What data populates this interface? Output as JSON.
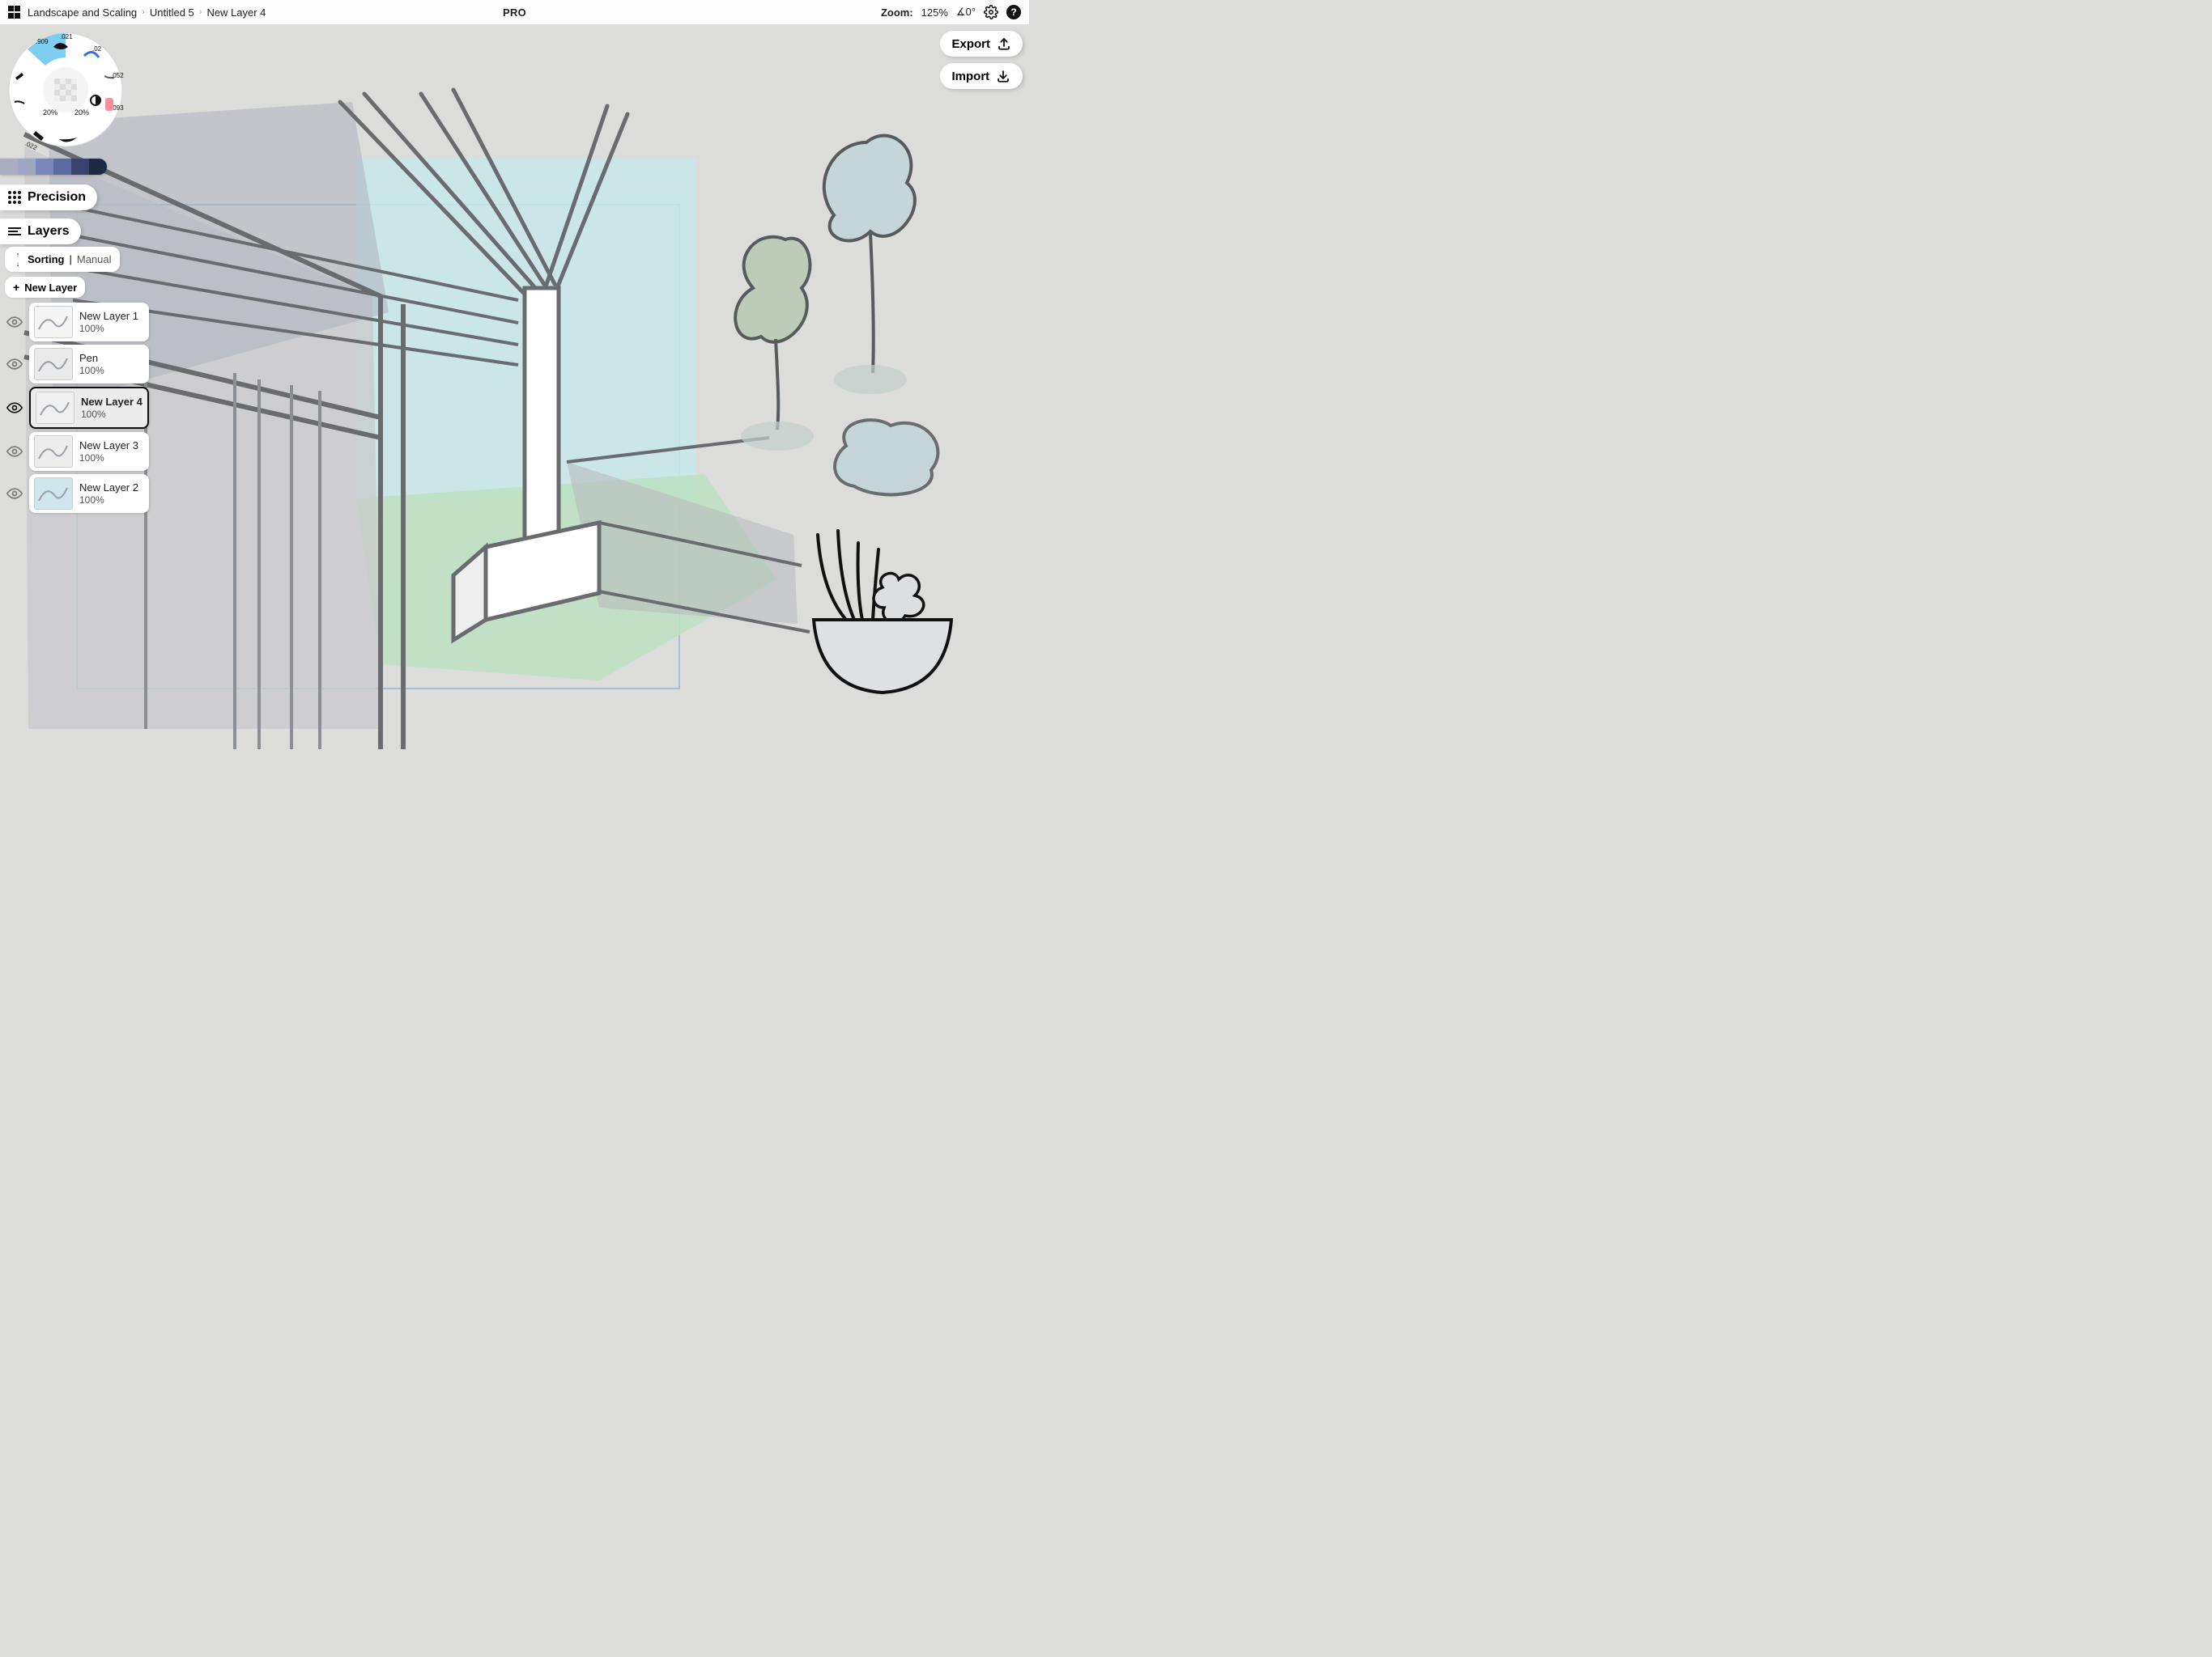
{
  "header": {
    "breadcrumbs": [
      "Landscape and Scaling",
      "Untitled 5",
      "New Layer 4"
    ],
    "center_label": "PRO",
    "zoom_label": "Zoom:",
    "zoom_value": "125%",
    "angle_value": "∡0°"
  },
  "io": {
    "export_label": "Export",
    "import_label": "Import"
  },
  "tool_wheel": {
    "brush_values": [
      ".909",
      ".021",
      ".02",
      ".052",
      ".093",
      ".022",
      ".022",
      ".022"
    ],
    "opacity_left": "20%",
    "opacity_right": "20%"
  },
  "color_swatches": [
    "#ababbf",
    "#9ea6c2",
    "#7a87b8",
    "#5b6aa0",
    "#38446f",
    "#1e2942"
  ],
  "tabs": {
    "precision_label": "Precision",
    "layers_label": "Layers"
  },
  "layers_panel": {
    "sorting_label": "Sorting",
    "sorting_separator": "|",
    "sorting_mode": "Manual",
    "new_layer_label": "New Layer",
    "layers": [
      {
        "name": "New Layer 1",
        "opacity": "100%",
        "selected": false,
        "thumb_color": "#f5f5f5"
      },
      {
        "name": "Pen",
        "opacity": "100%",
        "selected": false,
        "thumb_color": "#eaeaea"
      },
      {
        "name": "New Layer 4",
        "opacity": "100%",
        "selected": true,
        "thumb_color": "#f0f0f0"
      },
      {
        "name": "New Layer 3",
        "opacity": "100%",
        "selected": false,
        "thumb_color": "#ededed"
      },
      {
        "name": "New Layer 2",
        "opacity": "100%",
        "selected": false,
        "thumb_color": "#cfe7ec"
      }
    ]
  }
}
